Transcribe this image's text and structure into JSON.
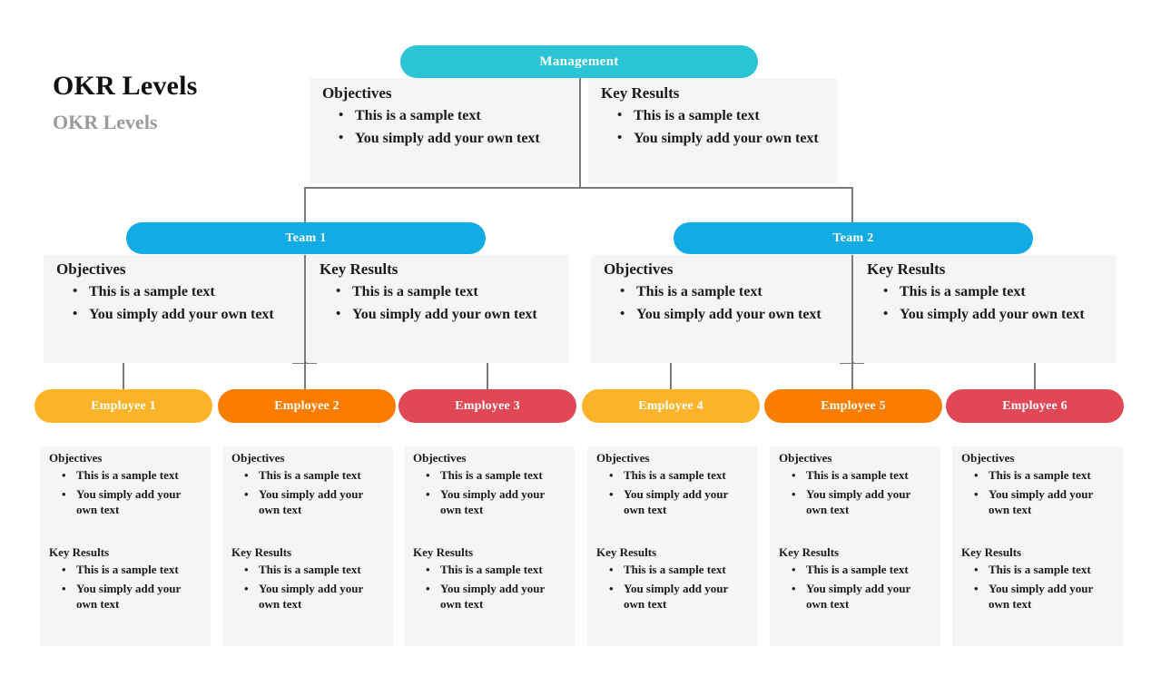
{
  "header": {
    "title": "OKR Levels",
    "subtitle": "OKR Levels"
  },
  "labels": {
    "objectives": "Objectives",
    "key_results": "Key Results",
    "bullet_1": "This is a sample text",
    "bullet_2": "You simply add your own text"
  },
  "colors": {
    "management": "#2BC4D4",
    "team": "#12ABE3",
    "employee_amber": "#FBB429",
    "employee_orange": "#FA7D00",
    "employee_crimson": "#E04856",
    "panel_bg": "#F5F5F5",
    "line": "#7A7A7A",
    "title": "#111111",
    "subtitle": "#9B9B9B"
  },
  "management": {
    "label": "Management",
    "objectives": {
      "heading": "Objectives",
      "items": [
        "This is a sample text",
        "You simply add your own text"
      ]
    },
    "key_results": {
      "heading": "Key Results",
      "items": [
        "This is a sample text",
        "You simply add your own text"
      ]
    }
  },
  "teams": [
    {
      "label": "Team 1",
      "objectives": {
        "heading": "Objectives",
        "items": [
          "This is a sample text",
          "You simply add your own text"
        ]
      },
      "key_results": {
        "heading": "Key Results",
        "items": [
          "This is a sample text",
          "You simply add your own text"
        ]
      }
    },
    {
      "label": "Team 2",
      "objectives": {
        "heading": "Objectives",
        "items": [
          "This is a sample text",
          "You simply add your own text"
        ]
      },
      "key_results": {
        "heading": "Key Results",
        "items": [
          "This is a sample text",
          "You simply add your own text"
        ]
      }
    }
  ],
  "employees": [
    {
      "label": "Employee 1",
      "color": "#FBB429",
      "objectives": {
        "heading": "Objectives",
        "items": [
          "This is a sample text",
          "You simply add your own text"
        ]
      },
      "key_results": {
        "heading": "Key Results",
        "items": [
          "This is a sample text",
          "You simply add your own text"
        ]
      }
    },
    {
      "label": "Employee 2",
      "color": "#FA7D00",
      "objectives": {
        "heading": "Objectives",
        "items": [
          "This is a sample text",
          "You simply add your own text"
        ]
      },
      "key_results": {
        "heading": "Key Results",
        "items": [
          "This is a sample text",
          "You simply add your own text"
        ]
      }
    },
    {
      "label": "Employee 3",
      "color": "#E04856",
      "objectives": {
        "heading": "Objectives",
        "items": [
          "This is a sample text",
          "You simply add your own text"
        ]
      },
      "key_results": {
        "heading": "Key Results",
        "items": [
          "This is a sample text",
          "You simply add your own text"
        ]
      }
    },
    {
      "label": "Employee 4",
      "color": "#FBB429",
      "objectives": {
        "heading": "Objectives",
        "items": [
          "This is a sample text",
          "You simply add your own text"
        ]
      },
      "key_results": {
        "heading": "Key Results",
        "items": [
          "This is a sample text",
          "You simply add your own text"
        ]
      }
    },
    {
      "label": "Employee 5",
      "color": "#FA7D00",
      "objectives": {
        "heading": "Objectives",
        "items": [
          "This is a sample text",
          "You simply add your own text"
        ]
      },
      "key_results": {
        "heading": "Key Results",
        "items": [
          "This is a sample text",
          "You simply add your own text"
        ]
      }
    },
    {
      "label": "Employee 6",
      "color": "#E04856",
      "objectives": {
        "heading": "Objectives",
        "items": [
          "This is a sample text",
          "You simply add your own text"
        ]
      },
      "key_results": {
        "heading": "Key Results",
        "items": [
          "This is a sample text",
          "You simply add your own text"
        ]
      }
    }
  ]
}
